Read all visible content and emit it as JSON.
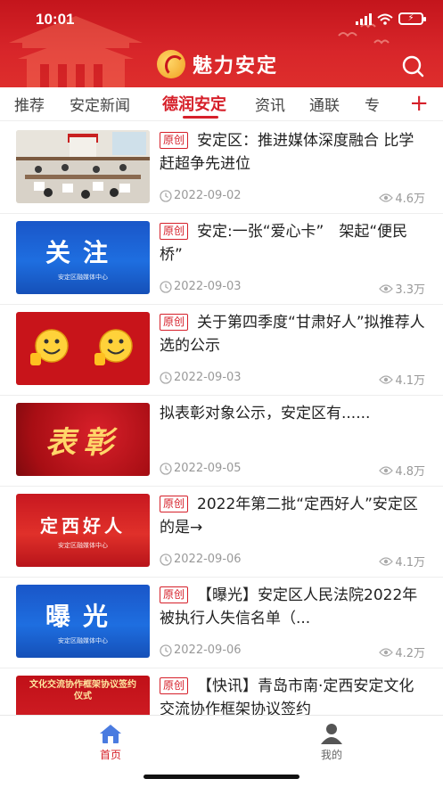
{
  "status_bar": {
    "time": "10:01",
    "battery": "⚡"
  },
  "header": {
    "app_title": "魅力安定"
  },
  "tabs": [
    {
      "label": "推荐"
    },
    {
      "label": "安定新闻"
    },
    {
      "label": "德润安定"
    },
    {
      "label": "资讯"
    },
    {
      "label": "通联"
    },
    {
      "label": "专"
    }
  ],
  "tab_add": "+",
  "colors": {
    "brand": "#d6202a",
    "header": "#c4151c",
    "muted": "#999999"
  },
  "articles": [
    {
      "badge": "原创",
      "title": "安定区：推进媒体深度融合 比学赶超争先进位",
      "date": "2022-09-02",
      "views": "4.6万",
      "thumb": "meeting-photo"
    },
    {
      "badge": "原创",
      "title": "安定:一张“爱心卡”　架起“便民桥”",
      "date": "2022-09-03",
      "views": "3.3万",
      "thumb": "关注",
      "thumb_sub": "安定区融媒体中心"
    },
    {
      "badge": "原创",
      "title": "关于第四季度“甘肃好人”拟推荐人选的公示",
      "date": "2022-09-03",
      "views": "4.1万",
      "thumb": "thumbs-up-emoji"
    },
    {
      "badge": "",
      "title": "拟表彰对象公示，安定区有......",
      "date": "2022-09-05",
      "views": "4.8万",
      "thumb": "表彰"
    },
    {
      "badge": "原创",
      "title": "2022年第二批“定西好人”安定区的是→",
      "date": "2022-09-06",
      "views": "4.1万",
      "thumb": "定西好人",
      "thumb_sub": "安定区融媒体中心"
    },
    {
      "badge": "原创",
      "title": "【曝光】安定区人民法院2022年被执行人失信名单（...",
      "date": "2022-09-06",
      "views": "4.2万",
      "thumb": "曝光",
      "thumb_sub": "安定区融媒体中心"
    },
    {
      "badge": "原创",
      "title": "【快讯】青岛市南·定西安定文化交流协作框架协议签约",
      "date": "",
      "views": "",
      "thumb": "文化交流协作框架协议签约仪式"
    }
  ],
  "bottom_nav": {
    "home": "首页",
    "mine": "我的"
  }
}
